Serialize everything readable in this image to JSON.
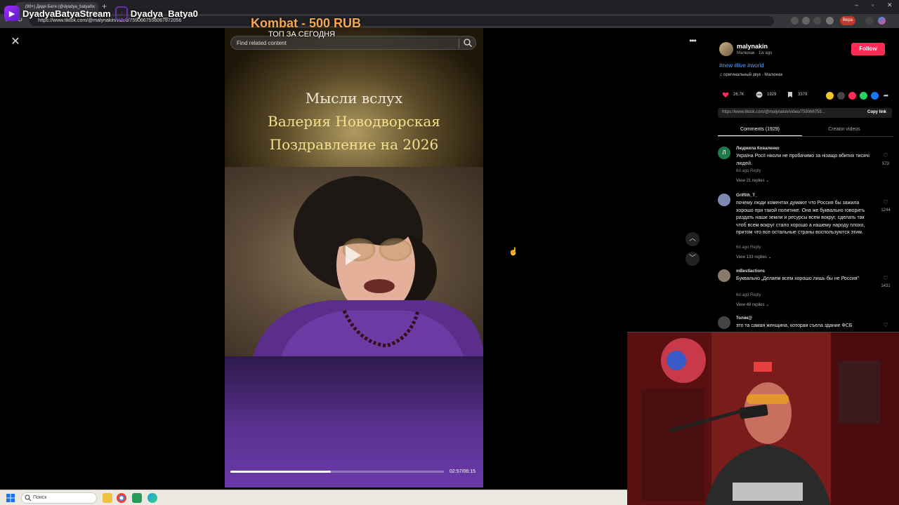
{
  "browser": {
    "tab_title": "(99+) Дядя Батя (@dyadya_batya0",
    "url": "https://www.tiktok.com/@malynakin/video/7590667556067872056",
    "profile_label": "Вера"
  },
  "overlay": {
    "brand_name": "DyadyaBatyaStream",
    "brand_handle": "Dyadya_Batya0",
    "kombat": "Kombat - 500 RUB",
    "top_today": "ТОП ЗА СЕГОДНЯ"
  },
  "video": {
    "search_placeholder": "Find related content",
    "title_line1": "Мысли вслух",
    "title_line2": "Валерия Новодворская",
    "title_line3": "Поздравление на 2026",
    "current_time": "02:57/06:15",
    "progress": 0.47
  },
  "panel": {
    "username": "malynakin",
    "meta": "Малюнак · 1w ago",
    "follow_label": "Follow",
    "tags": "#new #live #world",
    "music": "оригинальный звук - Малюнак",
    "likes": "26.7K",
    "comments_count": "1929",
    "saves": "3379",
    "link": "https://www.tiktok.com/@malynakin/video/759066755...",
    "copy_label": "Copy link",
    "tab_comments": "Comments (1929)",
    "tab_creator": "Creator videos"
  },
  "comments": [
    {
      "user": "Людмила Коваленко",
      "avatar_letter": "Л",
      "avatar_color": "#1e7a4a",
      "text": "Україна Росії ніколи не пробачимо за нізащо вбитих тисячі людей.",
      "meta": "6d ago    Reply",
      "replies": "View 21 replies ⌄",
      "likes": "573"
    },
    {
      "user": "Griffith_T_",
      "avatar_letter": "",
      "avatar_color": "#7a8ab0",
      "text": "почему люди коментах думают что Россия бы зажила хорошо при такой политике. Она же буквально говорить раздать наши земли и ресурсы всем вокруг, сделать так чтоб всем вокруг стало хорошо а нашему народу плохо, притом что все остальные страны воспользуются этим.",
      "meta": "6d ago    Reply",
      "replies": "View 133 replies ⌄",
      "likes": "1244"
    },
    {
      "user": "mBestIactions",
      "avatar_letter": "",
      "avatar_color": "#8a7a6a",
      "text": "Буквально „Делаем всем хорошо лишь бы не Россия\"",
      "meta": "6d ago    Reply",
      "replies": "View 48 replies ⌄",
      "likes": "1431"
    },
    {
      "user": "Толик@",
      "avatar_letter": "",
      "avatar_color": "#444",
      "text": "это та самая женщина, которая съела здание ФСБ",
      "meta": "",
      "replies": "",
      "likes": ""
    }
  ],
  "taskbar": {
    "search_label": "Поиск"
  },
  "colors": {
    "follow": "#fe2c55",
    "kombat": "#f5a74e",
    "tag": "#5aa0f5"
  }
}
